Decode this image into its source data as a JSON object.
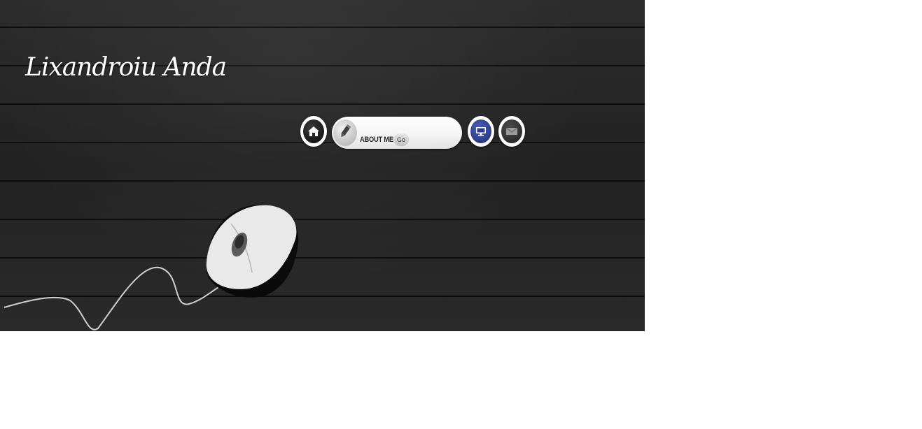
{
  "site": {
    "title": "Lixandroiu Anda"
  },
  "nav": {
    "home_icon": "home-icon",
    "about_icon": "pencil-icon",
    "about_label": "ABOUT ME",
    "go_label": "Go",
    "computer_icon": "monitor-icon",
    "mail_icon": "envelope-icon"
  },
  "colors": {
    "background": "#262626",
    "page": "#ffffff",
    "computer_button": "#2a3a94"
  }
}
